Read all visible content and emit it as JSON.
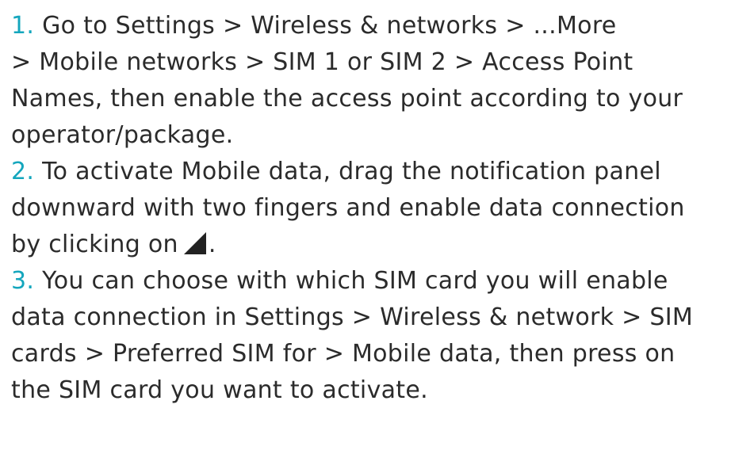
{
  "instructions": [
    {
      "number": "1.",
      "lines": [
        " Go to Settings > Wireless & networks > ...More",
        "> Mobile networks > SIM 1 or SIM 2 > Access Point",
        "Names, then enable the access point according to your",
        "operator/package."
      ]
    },
    {
      "number": "2.",
      "lines": [
        " To activate Mobile data, drag the notification panel",
        "downward with two fingers and enable data connection",
        "by clicking on",
        "."
      ],
      "icon": "signal-triangle-icon"
    },
    {
      "number": "3.",
      "lines": [
        " You can choose with which SIM card you will enable",
        "data connection in Settings > Wireless & network > SIM",
        "cards > Preferred SIM for  > Mobile data, then press on",
        "the SIM card you want to activate."
      ]
    }
  ],
  "colors": {
    "number_accent": "#14a6bd",
    "text": "#2b2b2b",
    "icon": "#222222"
  }
}
